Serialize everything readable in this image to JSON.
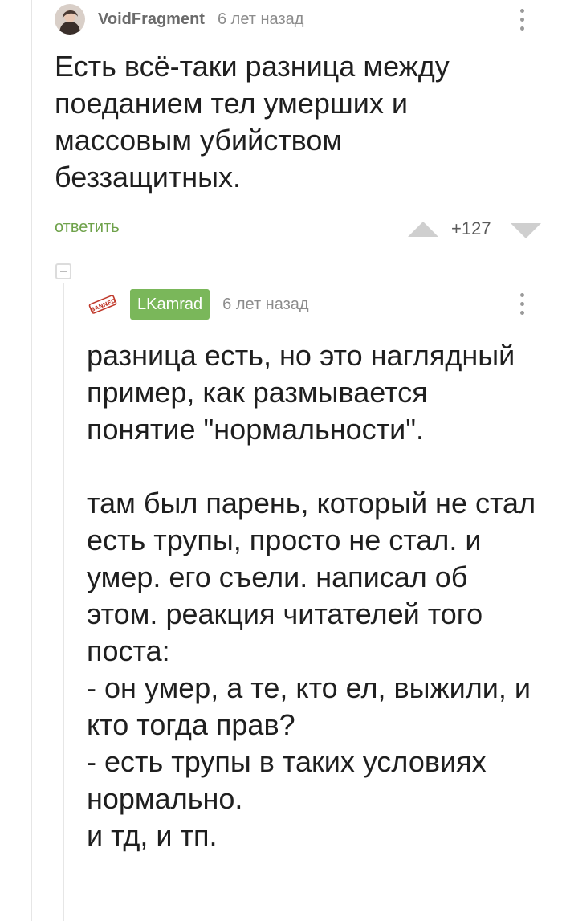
{
  "comments": [
    {
      "author": "VoidFragment",
      "time": "6 лет назад",
      "text": "Есть всё-таки разница между поеданием тел умерших и массовым убийством беззащитных.",
      "actions": {
        "reply_label": "ответить"
      },
      "rating": "+127",
      "menu_icon": "more-vertical-icon"
    },
    {
      "author": "LKamrad",
      "author_badge": "BANNED",
      "time": "6 лет назад",
      "paragraphs": [
        [
          "разница есть, но это наглядный пример, как размывается понятие \"нормальности\"."
        ],
        [
          "там был парень, который не стал есть трупы, просто не стал. и умер. его съели. написал об этом. реакция читателей того поста:",
          "- он умер, а те, кто ел, выжили, и кто тогда прав?",
          "- есть трупы в таких условиях нормально.",
          "и тд, и тп."
        ]
      ],
      "menu_icon": "more-vertical-icon"
    }
  ],
  "colors": {
    "reply_green": "#6fa24b",
    "author_tag_green": "#7ab75a",
    "vote_arrow_gray": "#cfcfcf",
    "thread_line": "#e6e6e6"
  }
}
